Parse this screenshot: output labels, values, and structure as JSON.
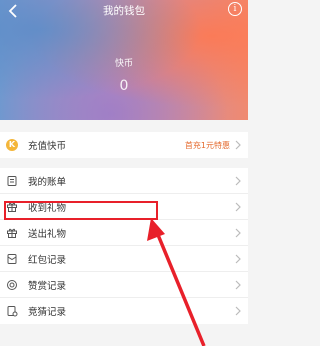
{
  "header": {
    "title": "我的钱包",
    "back_icon": "back-arrow-icon",
    "info_icon": "info-icon",
    "info_glyph": "i"
  },
  "balance": {
    "label": "快币",
    "value": "0"
  },
  "recharge": {
    "label": "充值快币",
    "promo": "首充1元特惠",
    "icon": "coin-icon",
    "icon_glyph": "K"
  },
  "menu": {
    "items": [
      {
        "label": "我的账单",
        "icon": "bill-icon"
      },
      {
        "label": "收到礼物",
        "icon": "gift-received-icon"
      },
      {
        "label": "送出礼物",
        "icon": "gift-sent-icon"
      },
      {
        "label": "红包记录",
        "icon": "red-packet-icon"
      },
      {
        "label": "赞赏记录",
        "icon": "appreciation-icon"
      },
      {
        "label": "竞猜记录",
        "icon": "quiz-icon"
      }
    ]
  },
  "annotation": {
    "highlight_color": "#e8202a",
    "highlighted_item": "收到礼物"
  },
  "colors": {
    "accent": "#e46a2e",
    "coin": "#f4b63a"
  }
}
